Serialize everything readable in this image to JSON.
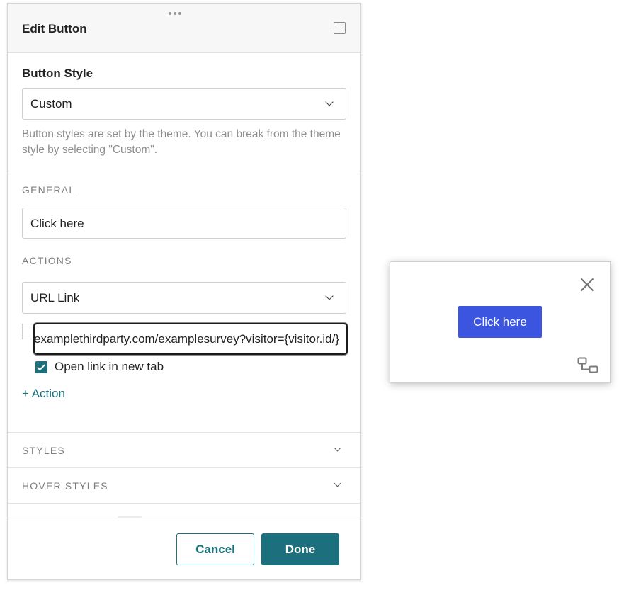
{
  "panel": {
    "title": "Edit Button",
    "button_style": {
      "label": "Button Style",
      "selected": "Custom",
      "help": "Button styles are set by the theme. You can break from the theme style by selecting \"Custom\"."
    },
    "general": {
      "label": "GENERAL",
      "button_text": "Click here"
    },
    "actions": {
      "label": "ACTIONS",
      "action_type": "URL Link",
      "url": "https://www.examplethirdparty.com/examplesurvey?visitor={visitor.id/}",
      "open_new_tab_label": "Open link in new tab",
      "open_new_tab_checked": true,
      "add_action_label": "+ Action"
    },
    "accordions": [
      {
        "label": "STYLES"
      },
      {
        "label": "HOVER STYLES"
      }
    ],
    "footer": {
      "cancel_label": "Cancel",
      "done_label": "Done"
    }
  },
  "preview": {
    "button_label": "Click here",
    "button_color": "#3b55e0"
  },
  "colors": {
    "accent": "#1c6f7c"
  },
  "icons": {
    "drag": "drag-handle-icon",
    "collapse": "collapse-icon",
    "chevron": "chevron-down-icon",
    "close": "close-icon",
    "move": "move-icon",
    "check": "check-icon"
  }
}
